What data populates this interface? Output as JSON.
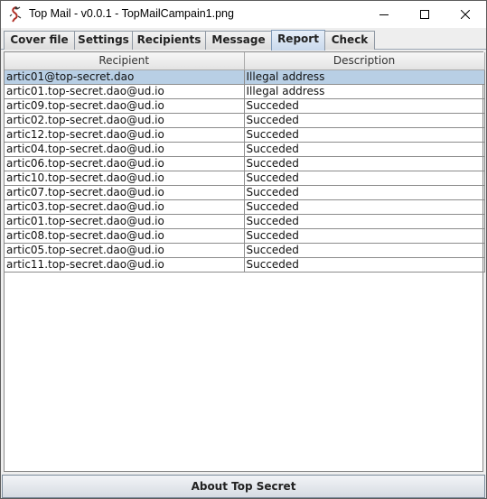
{
  "window": {
    "title": "Top Mail - v0.0.1 - TopMailCampain1.png",
    "icon": "top-mail-logo-icon"
  },
  "tabs": [
    {
      "label": "Cover file",
      "active": false
    },
    {
      "label": "Settings",
      "active": false
    },
    {
      "label": "Recipients",
      "active": false
    },
    {
      "label": "Message",
      "active": false
    },
    {
      "label": "Report",
      "active": true
    },
    {
      "label": "Check",
      "active": false
    }
  ],
  "report": {
    "columns": [
      "Recipient",
      "Description"
    ],
    "rows": [
      {
        "recipient": "artic01@top-secret.dao",
        "description": "Illegal address",
        "selected": true
      },
      {
        "recipient": "artic01.top-secret.dao@ud.io",
        "description": "Illegal address"
      },
      {
        "recipient": "artic09.top-secret.dao@ud.io",
        "description": "Succeded"
      },
      {
        "recipient": "artic02.top-secret.dao@ud.io",
        "description": "Succeded"
      },
      {
        "recipient": "artic12.top-secret.dao@ud.io",
        "description": "Succeded"
      },
      {
        "recipient": "artic04.top-secret.dao@ud.io",
        "description": "Succeded"
      },
      {
        "recipient": "artic06.top-secret.dao@ud.io",
        "description": "Succeded"
      },
      {
        "recipient": "artic10.top-secret.dao@ud.io",
        "description": "Succeded"
      },
      {
        "recipient": "artic07.top-secret.dao@ud.io",
        "description": "Succeded"
      },
      {
        "recipient": "artic03.top-secret.dao@ud.io",
        "description": "Succeded"
      },
      {
        "recipient": "artic01.top-secret.dao@ud.io",
        "description": "Succeded"
      },
      {
        "recipient": "artic08.top-secret.dao@ud.io",
        "description": "Succeded"
      },
      {
        "recipient": "artic05.top-secret.dao@ud.io",
        "description": "Succeded"
      },
      {
        "recipient": "artic11.top-secret.dao@ud.io",
        "description": "Succeded"
      }
    ]
  },
  "footer": {
    "about_label": "About Top Secret"
  },
  "colors": {
    "selected_row": "#b8cfe5",
    "active_tab": "#c9d9ec",
    "logo_red": "#c0392b"
  }
}
